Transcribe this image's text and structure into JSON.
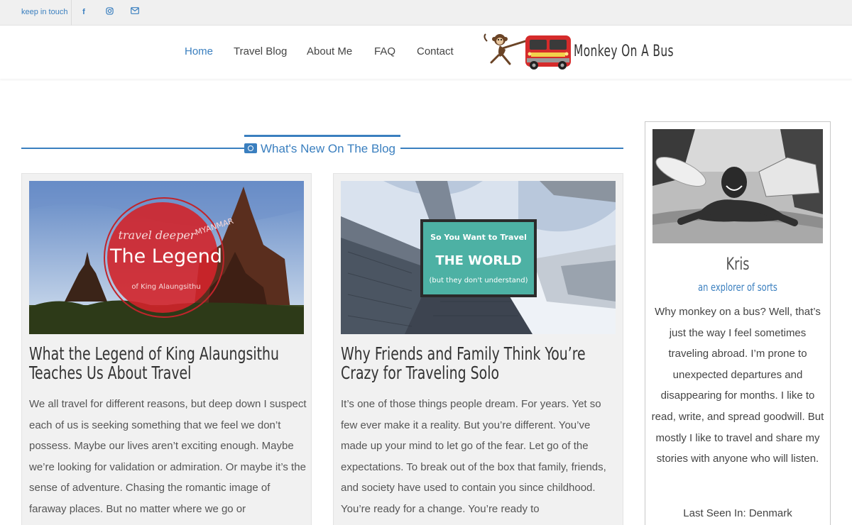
{
  "topbar": {
    "keep_in_touch": "keep in touch",
    "social": [
      {
        "icon": "facebook-icon",
        "glyph": "f"
      },
      {
        "icon": "instagram-icon",
        "glyph": "◎"
      },
      {
        "icon": "email-icon",
        "glyph": "✉"
      }
    ]
  },
  "nav": {
    "items": [
      {
        "label": "Home",
        "active": true
      },
      {
        "label": "Travel Blog",
        "active": false
      },
      {
        "label": "About Me",
        "active": false
      },
      {
        "label": "FAQ",
        "active": false
      },
      {
        "label": "Contact",
        "active": false
      }
    ]
  },
  "logo": {
    "text": "Monkey On A Bus",
    "bus_color": "#d52b2b"
  },
  "section": {
    "title": "What's New On The Blog",
    "icon": "camera-icon"
  },
  "posts": [
    {
      "title": "What the Legend of King Alaungsithu Teaches Us About Travel",
      "excerpt": "We all travel for different reasons, but deep down I suspect each of us is seeking something that we feel we don’t possess. Maybe our lives aren’t exciting enough. Maybe we’re looking for validation or admiration. Or maybe it’s the sense of adventure. Chasing the romantic image of faraway places. But no matter where we go or",
      "image": {
        "line1": "travel deeper",
        "line2": "MYANMAR",
        "line3": "The Legend",
        "line4": "of King Alaungsithu"
      }
    },
    {
      "title": "Why Friends and Family Think You’re Crazy for Traveling Solo",
      "excerpt": "It’s one of those things people dream. For years. Yet so few ever make it a reality. But you’re different. You’ve made up your mind to let go of the fear. Let go of the expectations. To break out of the box that family, friends, and society have used to contain you since childhood. You’re ready for a change. You’re ready to",
      "image": {
        "line1": "So You Want to Travel",
        "line2": "THE WORLD",
        "line3": "(but they don't understand)"
      }
    }
  ],
  "sidebar": {
    "name": "Kris",
    "tagline": "an explorer of sorts",
    "bio": "Why monkey on a bus? Well, that’s just the way I feel sometimes traveling abroad. I’m prone to unexpected departures and disappearing for months. I like to read, write, and spread goodwill. But mostly I like to travel and share my stories with anyone who will listen.",
    "last_seen": "Last Seen In: Denmark"
  },
  "colors": {
    "accent": "#3a7fbf",
    "card_bg": "#f1f1f1"
  }
}
